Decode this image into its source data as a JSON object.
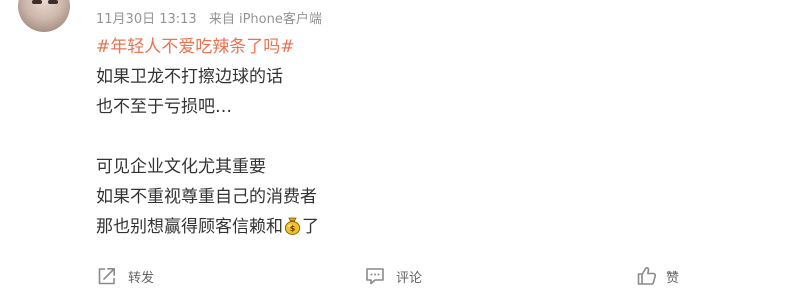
{
  "post": {
    "timestamp": "11月30日 13:13",
    "source": "来自 iPhone客户端",
    "topic": "#年轻人不爱吃辣条了吗#",
    "lines": [
      "如果卫龙不打擦边球的话",
      "也不至于亏损吧…",
      "可见企业文化尤其重要",
      "如果不重视尊重自己的消费者",
      "那也别想赢得顾客信赖和",
      "了"
    ],
    "emoji_name": "money-bag-icon"
  },
  "actions": {
    "forward_label": "转发",
    "comment_label": "评论",
    "like_label": "赞"
  },
  "colors": {
    "topic": "#eb7350",
    "text": "#333333",
    "meta": "#939393",
    "action": "#636363"
  }
}
